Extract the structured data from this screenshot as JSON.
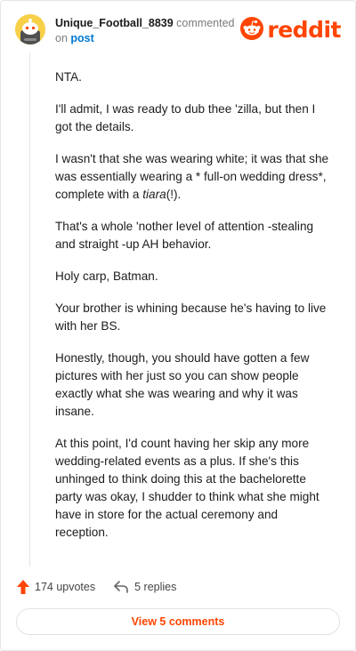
{
  "header": {
    "username": "Unique_Football_8839",
    "action": "commented",
    "on_text": "on",
    "post_link": "post",
    "logo_text": "reddit"
  },
  "comment": {
    "paragraphs": [
      "NTA.",
      "I'll admit, I was ready to dub thee 'zilla, but then I got the details.",
      "I wasn't that she was wearing white; it was that she was essentially wearing a * full-on wedding dress*, complete with a ",
      "That's a whole 'nother level of attention -stealing and straight -up AH behavior.",
      "Holy carp, Batman.",
      "Your brother is whining because he's having to live with her BS.",
      "Honestly, though, you should have gotten a few pictures with her just so you can show people exactly what she was wearing and why it was insane.",
      "At this point, I'd count having her skip any more wedding-related events as a plus. If she's this unhinged to think doing this at the bachelorette party was okay, I shudder to think what she might have in store for the actual ceremony and reception."
    ],
    "p3_italic": "tiara",
    "p3_tail": "(!)."
  },
  "actions": {
    "upvotes": "174 upvotes",
    "replies": "5 replies"
  },
  "view_button": "View 5 comments",
  "colors": {
    "brand": "#ff4500",
    "link": "#0079d3",
    "avatar_bg": "#f7d04a"
  },
  "icons": {
    "avatar": "snoo-avatar-icon",
    "logo": "reddit-snoo-icon",
    "upvote": "upvote-arrow-icon",
    "reply": "reply-arrow-icon"
  }
}
